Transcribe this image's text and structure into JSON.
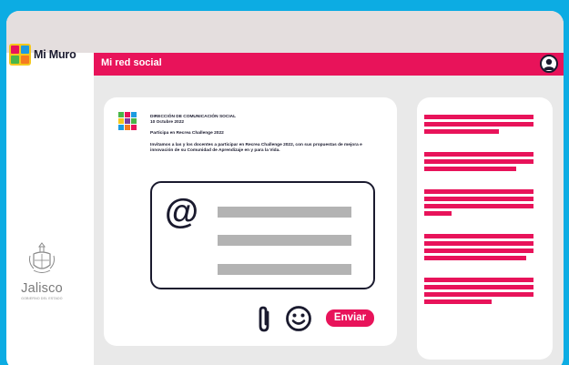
{
  "app": {
    "logo_text": "Mi Muro",
    "logo_tiles": [
      "#e8135a",
      "#1c9be0",
      "#49b649",
      "#f47b20"
    ],
    "section_title": "Mi red social",
    "accent_color": "#e8135a",
    "background_color": "#0cace3"
  },
  "sidebar": {
    "brand_name": "Jalisco",
    "brand_subtitle": "GOBIERNO DEL ESTADO"
  },
  "post": {
    "author": "DIRECCIÓN DE COMUNICACIÓN SOCIAL",
    "date": "10 Octubre 2022",
    "subject": "Participa en Recrea Challenge 2022",
    "body": "Invitamos a las y los docentes a participar en Recrea Challenge 2022, con sus propuestas de mejora e innovación de su Comunidad de Aprendizaje en y para la Vida."
  },
  "compose": {
    "at_symbol": "@",
    "attach_icon": "paperclip-icon",
    "emoji_icon": "smiley-icon",
    "send_label": "Enviar"
  }
}
